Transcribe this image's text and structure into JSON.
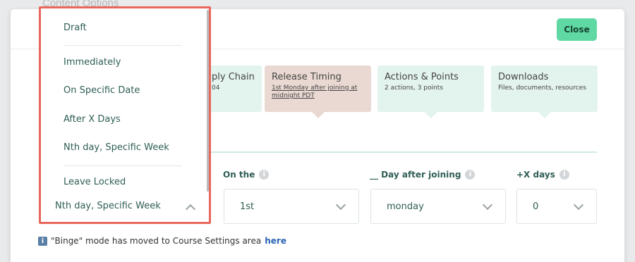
{
  "background": {
    "title": "Content Options"
  },
  "header": {
    "close_label": "Close"
  },
  "cards": {
    "partial": {
      "title": "ply Chain",
      "subtitle": "04"
    },
    "release": {
      "title": "Release Timing",
      "subtitle": "1st Monday after joining at midnight PDT"
    },
    "actions": {
      "title": "Actions & Points",
      "subtitle": "2 actions, 3 points"
    },
    "downloads": {
      "title": "Downloads",
      "subtitle": "Files, documents, resources"
    }
  },
  "fields": {
    "on_the": {
      "label": "On the",
      "value": "1st"
    },
    "day_after": {
      "label": "__ Day after joining",
      "value": "monday"
    },
    "plus_days": {
      "label": "+X days",
      "value": "0"
    }
  },
  "dropdown": {
    "items": [
      "Draft",
      "Immediately",
      "On Specific Date",
      "After X Days",
      "Nth day, Specific Week",
      "Leave Locked"
    ],
    "selected": "Nth day, Specific Week"
  },
  "binge": {
    "text": "\"Binge\" mode has moved to Course Settings area",
    "link": "here"
  },
  "colors": {
    "accent_green": "#5fd8a3",
    "highlight_border": "#e8675c",
    "card_bg": "#e3f3ee",
    "card_active_bg": "#ead9d2",
    "text_teal": "#2f5e55"
  },
  "icons": [
    "chevron-down-icon",
    "chevron-up-icon",
    "info-icon"
  ]
}
